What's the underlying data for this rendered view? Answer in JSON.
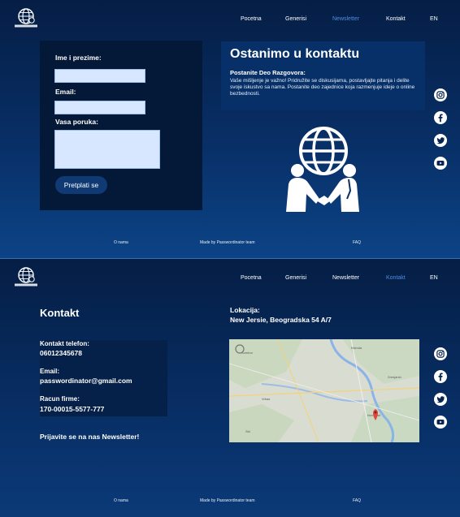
{
  "brand": {
    "logo_text": "PASSWORDINATOR"
  },
  "nav": {
    "items": [
      "Pocetna",
      "Generisi",
      "Newsletter",
      "Kontakt",
      "EN"
    ]
  },
  "page1": {
    "active_nav": "Newsletter",
    "form": {
      "name_label": "Ime i prezime:",
      "email_label": "Email:",
      "message_label": "Vasa poruka:",
      "submit_label": "Pretplati se"
    },
    "contact": {
      "title": "Ostanimo u kontaktu",
      "subtitle": "Postanite Deo Razgovora:",
      "body": "Vaše mišljenje je važno! Pridružite se diskusijama, postavljajte pitanja i delite svoje iskustvo sa nama. Postanite deo zajednice koja razmenjuje ideje o online bezbednosti."
    }
  },
  "page2": {
    "active_nav": "Kontakt",
    "title": "Kontakt",
    "phone_label": "Kontakt telefon:",
    "phone_value": "06012345678",
    "email_label": "Email:",
    "email_value": "passwordinator@gmail.com",
    "account_label": "Racun firme:",
    "account_value": "170-00015-5577-777",
    "newsletter_text": "Prijavite se na nas Newsletter!",
    "location_label": "Lokacija:",
    "location_value": "New Jersie, Beogradska 54 A/7"
  },
  "footer": {
    "about": "O nama",
    "made_by": "Made by Passwordinator team",
    "faq": "FAQ"
  },
  "social_icons": [
    "instagram-icon",
    "facebook-icon",
    "twitter-icon",
    "youtube-icon"
  ],
  "colors": {
    "background": "#06244f",
    "accent": "#4d8fe3",
    "input": "#d6e7ff",
    "button": "#0f3a73"
  }
}
